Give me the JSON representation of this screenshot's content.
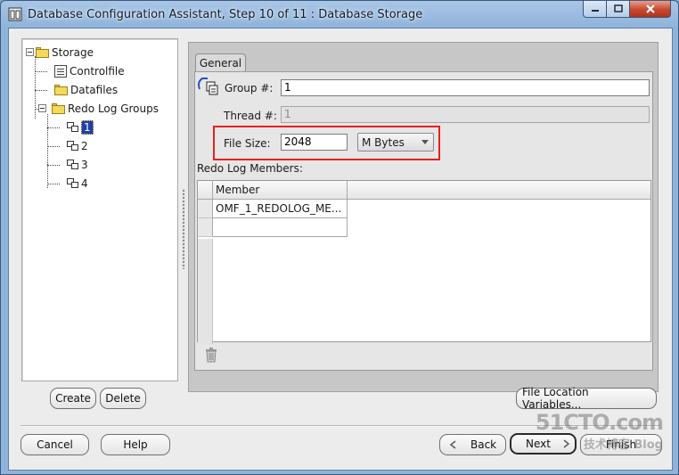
{
  "window": {
    "title": "Database Configuration Assistant, Step 10 of 11 : Database Storage",
    "controls": {
      "minimize": "minimize",
      "maximize": "maximize",
      "close": "close"
    }
  },
  "tree": {
    "root": "Storage",
    "items": [
      "Controlfile",
      "Datafiles",
      "Redo Log Groups"
    ],
    "groups": [
      "1",
      "2",
      "3",
      "4"
    ],
    "selected_group": "1"
  },
  "tree_buttons": {
    "create": "Create",
    "delete": "Delete"
  },
  "tab": {
    "label": "General"
  },
  "form": {
    "group_label": "Group #:",
    "group_value": "1",
    "thread_label": "Thread #:",
    "thread_value": "1",
    "file_size_label": "File Size:",
    "file_size_value": "2048",
    "unit_selected": "M Bytes",
    "members_label": "Redo Log Members:"
  },
  "table": {
    "columns": [
      "Member"
    ],
    "rows": [
      "OMF_1_REDOLOG_ME...",
      ""
    ]
  },
  "buttons": {
    "file_location": "File Location Variables...",
    "cancel": "Cancel",
    "help": "Help",
    "back": "Back",
    "next": "Next",
    "finish": "Finish"
  },
  "watermark": {
    "line1": "51CTO.com",
    "line2": "技术博客  Blog"
  },
  "colors": {
    "highlight": "#e8201c",
    "selection": "#1f3fa8"
  },
  "icons": {
    "back": "chevron-left-icon",
    "next": "chevron-right-icon",
    "trash": "trash-icon"
  }
}
